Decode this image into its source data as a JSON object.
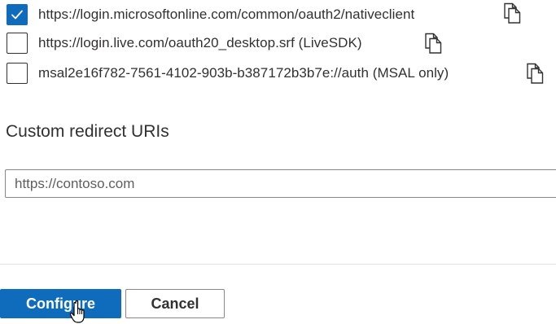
{
  "redirect_uris": {
    "items": [
      {
        "uri": "https://login.microsoftonline.com/common/oauth2/nativeclient",
        "checked": true
      },
      {
        "uri": "https://login.live.com/oauth20_desktop.srf (LiveSDK)",
        "checked": false
      },
      {
        "uri": "msal2e16f782-7561-4102-903b-b387172b3b7e://auth (MSAL only)",
        "checked": false
      }
    ],
    "copy_icon": "copy-icon",
    "check_icon": "checkmark-icon"
  },
  "custom_redirect": {
    "title": "Custom redirect URIs",
    "placeholder": "https://contoso.com",
    "value": ""
  },
  "footer": {
    "configure_label": "Configure",
    "cancel_label": "Cancel",
    "cursor_icon": "hand-pointer-icon"
  },
  "colors": {
    "accent": "#0f6cbd",
    "text": "#323130",
    "border": "#8a8886",
    "divider": "#e1dfdd"
  }
}
